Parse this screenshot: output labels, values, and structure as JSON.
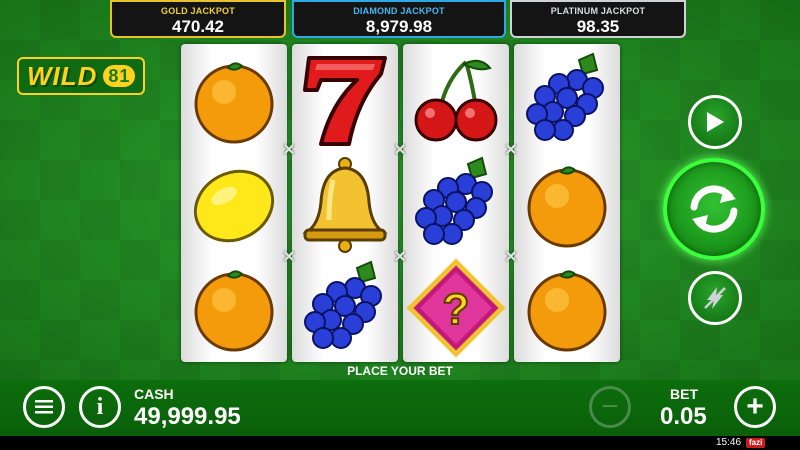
{
  "jackpots": {
    "gold": {
      "label": "GOLD JACKPOT",
      "value": "470.42"
    },
    "diamond": {
      "label": "DIAMOND JACKPOT",
      "value": "8,979.98"
    },
    "platinum": {
      "label": "PLATINUM JACKPOT",
      "value": "98.35"
    }
  },
  "logo": {
    "word": "WILD",
    "number": "81"
  },
  "reels": [
    [
      "orange",
      "lemon",
      "orange"
    ],
    [
      "seven",
      "bell",
      "grapes"
    ],
    [
      "cherries",
      "grapes",
      "mystery"
    ],
    [
      "grapes",
      "orange",
      "orange"
    ]
  ],
  "status_message": "PLACE YOUR BET",
  "cash": {
    "label": "CASH",
    "value": "49,999.95"
  },
  "bet": {
    "label": "BET",
    "value": "0.05"
  },
  "controls": {
    "menu_icon": "menu-icon",
    "info_icon": "info-icon",
    "info_glyph": "i",
    "play_icon": "play-icon",
    "spin_icon": "spin-icon",
    "turbo_icon": "turbo-icon",
    "minus_glyph": "−",
    "plus_glyph": "+"
  },
  "system": {
    "clock": "15:46",
    "brand": "fazi"
  },
  "colors": {
    "background": "#1f9a1f",
    "gold_border": "#e7c22a",
    "diamond_border": "#2ea7e6",
    "platinum_border": "#cfd3d6",
    "spin_glow": "#3cff3c"
  }
}
